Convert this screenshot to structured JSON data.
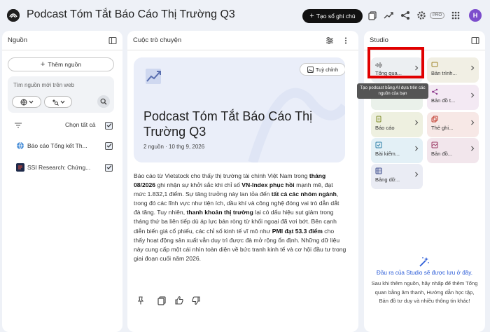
{
  "header": {
    "title": "Podcast Tóm Tắt Báo Cáo Thị Trường Q3",
    "new_notebook_label": "Tạo sổ ghi chú",
    "pro_badge": "PRO",
    "avatar_initial": "H"
  },
  "sources": {
    "title": "Nguồn",
    "add_label": "Thêm nguồn",
    "search_placeholder": "Tìm nguồn mới trên web",
    "select_all_label": "Chọn tất cả",
    "items": [
      {
        "label": "Báo cáo Tổng kết Th...",
        "checked": true,
        "icon": "globe-icon"
      },
      {
        "label": "SSI Research: Chứng...",
        "checked": true,
        "icon": "document-icon"
      }
    ]
  },
  "chat": {
    "title": "Cuộc trò chuyện",
    "customize_label": "Tuỳ chỉnh",
    "card_title": "Podcast Tóm Tắt Báo Cáo Thị Trường Q3",
    "card_meta": "2 nguồn · 10 thg 9, 2026",
    "summary": [
      {
        "text": "Báo cáo từ Vietstock cho thấy thị trường tài chính Việt Nam trong ",
        "bold": false
      },
      {
        "text": "tháng 08/2026",
        "bold": true
      },
      {
        "text": " ghi nhận sự khởi sắc khi chỉ số ",
        "bold": false
      },
      {
        "text": "VN-Index phục hồi",
        "bold": true
      },
      {
        "text": " mạnh mẽ, đạt mức 1.832,1 điểm. Sự tăng trưởng này lan tỏa đến ",
        "bold": false
      },
      {
        "text": "tất cả các nhóm ngành",
        "bold": true
      },
      {
        "text": ", trong đó các lĩnh vực như tiện ích, dầu khí và công nghệ đóng vai trò dẫn dắt đà tăng. Tuy nhiên, ",
        "bold": false
      },
      {
        "text": "thanh khoản thị trường",
        "bold": true
      },
      {
        "text": " lại có dấu hiệu sụt giảm trong tháng thứ ba liên tiếp dù áp lực bán ròng từ khối ngoại đã vơi bớt. Bên cạnh diễn biến giá cổ phiếu, các chỉ số kinh tế vĩ mô như ",
        "bold": false
      },
      {
        "text": "PMI đạt 53.3 điểm",
        "bold": true
      },
      {
        "text": " cho thấy hoạt động sản xuất vẫn duy trì được đà mở rộng ổn định. Những dữ liệu này cung cấp một cái nhìn toàn diện về bức tranh kinh tế và cơ hội đầu tư trong giai đoạn cuối năm 2026.",
        "bold": false
      }
    ]
  },
  "studio": {
    "title": "Studio",
    "tiles": [
      {
        "label": "Tổng qua...",
        "bg": "#eceff2",
        "accent": "#6b6b6b",
        "icon": "audio-overview-icon"
      },
      {
        "label": "Bản trình...",
        "bg": "#f1efe4",
        "accent": "#a0862a",
        "icon": "presentation-icon"
      },
      {
        "label": "",
        "bg": "#eaf1ea",
        "accent": "#3d8a3d",
        "icon": "video-icon"
      },
      {
        "label": "Bản đồ t...",
        "bg": "#f3e9f3",
        "accent": "#8e3c8e",
        "icon": "mind-map-icon"
      },
      {
        "label": "Báo cáo",
        "bg": "#eef0e0",
        "accent": "#7d8a25",
        "icon": "report-icon"
      },
      {
        "label": "Thẻ ghi...",
        "bg": "#f7e8e6",
        "accent": "#c0392b",
        "icon": "flashcard-icon"
      },
      {
        "label": "Bài kiểm...",
        "bg": "#e3f0f6",
        "accent": "#2d7fa8",
        "icon": "quiz-icon"
      },
      {
        "label": "Bản đồ...",
        "bg": "#f2e6ec",
        "accent": "#9c3c66",
        "icon": "infographic-icon"
      },
      {
        "label": "Bảng dữ...",
        "bg": "#eaecf4",
        "accent": "#3b4a8a",
        "icon": "data-table-icon"
      }
    ],
    "tooltip": "Tạo podcast bằng AI dựa trên các nguồn của bạn",
    "empty_title": "Đầu ra của Studio sẽ được lưu ở đây.",
    "empty_desc": "Sau khi thêm nguồn, hãy nhấp để thêm Tổng quan bằng âm thanh, Hướng dẫn học tập, Bản đồ tư duy và nhiều thông tin khác!"
  },
  "colors": {
    "page_bg": "#eef1f7",
    "card_bg": "#eaeef9",
    "highlight": "#e10000",
    "link_blue": "#2a5bd7"
  }
}
